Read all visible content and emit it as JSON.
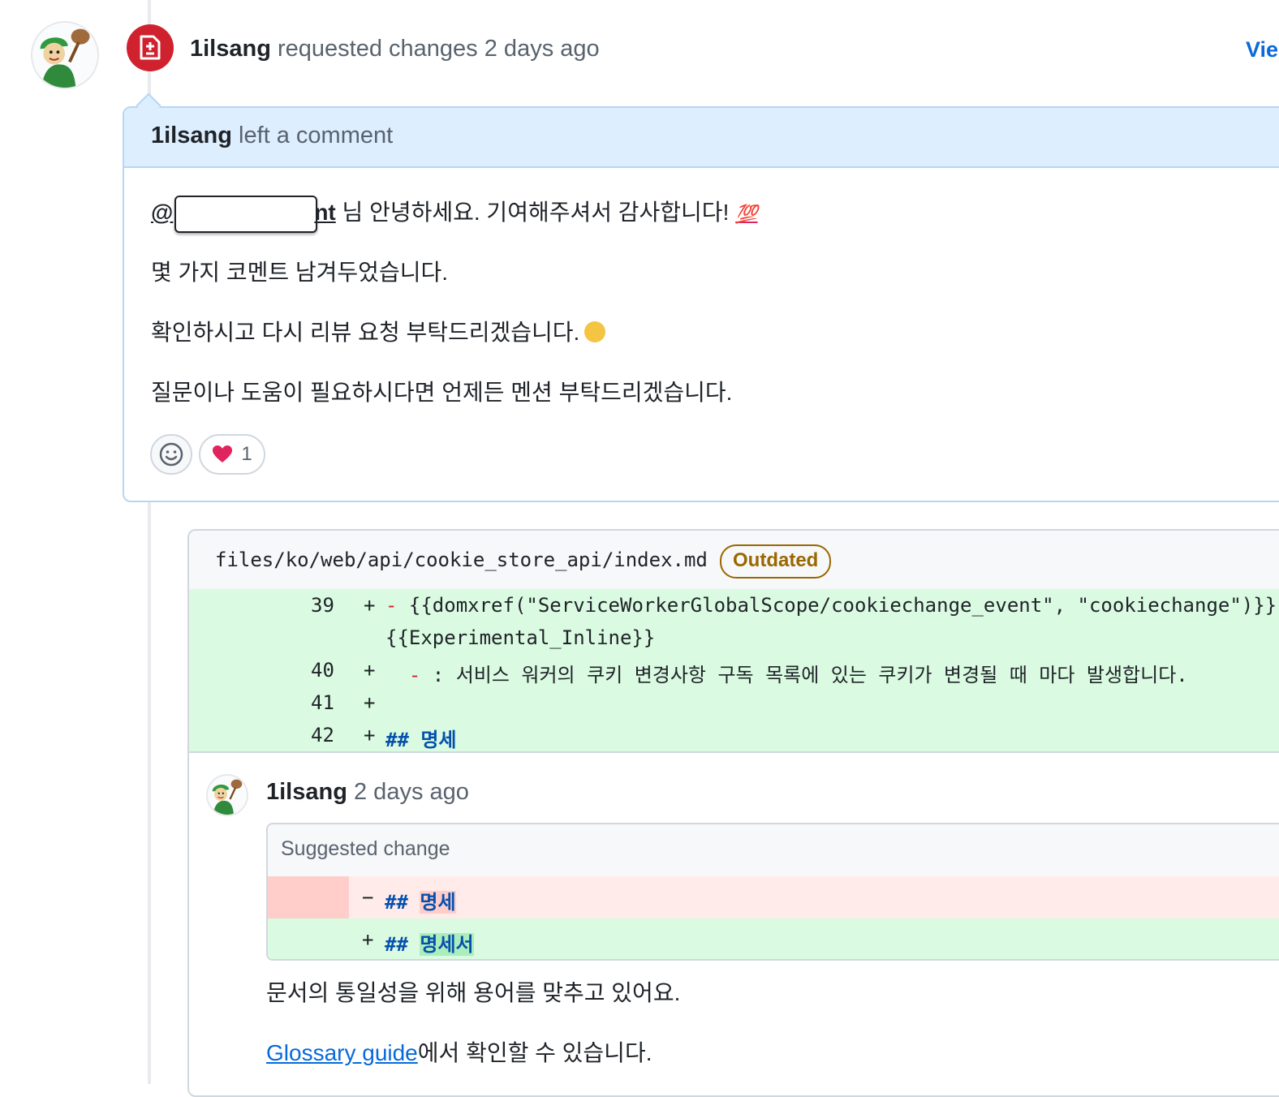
{
  "review": {
    "author": "1ilsang",
    "action": "requested changes",
    "time": "2 days ago",
    "view_link": "Vie"
  },
  "comment": {
    "author": "1ilsang",
    "action": "left a comment",
    "mention_prefix": "@",
    "mention_suffix": "nt",
    "line1_text": " 님 안녕하세요. 기여해주셔서 감사합니다! ",
    "line1_emoji": "💯",
    "line2": "몇 가지 코멘트 남겨두었습니다.",
    "line3": "확인하시고 다시 리뷰 요청 부탁드리겠습니다.",
    "line4": "질문이나 도움이 필요하시다면 언제든 멘션 부탁드리겠습니다.",
    "reaction_heart_count": "1"
  },
  "file": {
    "path": "files/ko/web/api/cookie_store_api/index.md",
    "badge": "Outdated",
    "lines": [
      {
        "num": "39",
        "sign": "+",
        "dash": "-",
        "code": " {{domxref(\"ServiceWorkerGlobalScope/cookiechange_event\", \"cookiechange\")}}"
      },
      {
        "num": "",
        "sign": "",
        "dash": "",
        "code": "{{Experimental_Inline}}"
      },
      {
        "num": "40",
        "sign": "+",
        "dash": "  -",
        "code": " : 서비스 워커의 쿠키 변경사항 구독 목록에 있는 쿠키가 변경될 때 마다 발생합니다."
      },
      {
        "num": "41",
        "sign": "+",
        "dash": "",
        "code": ""
      },
      {
        "num": "42",
        "sign": "+",
        "dash": "",
        "head_mark": "##",
        "code": " 명세"
      }
    ]
  },
  "reply": {
    "author": "1ilsang",
    "time": "2 days ago",
    "suggestion_title": "Suggested change",
    "del_sign": "−",
    "del_mark": "##",
    "del_word": "명세",
    "add_sign": "+",
    "add_mark": "##",
    "add_word": "명세서",
    "text1": "문서의 통일성을 위해 용어를 맞추고 있어요.",
    "link_text": "Glossary guide",
    "text2": "에서 확인할 수 있습니다."
  }
}
